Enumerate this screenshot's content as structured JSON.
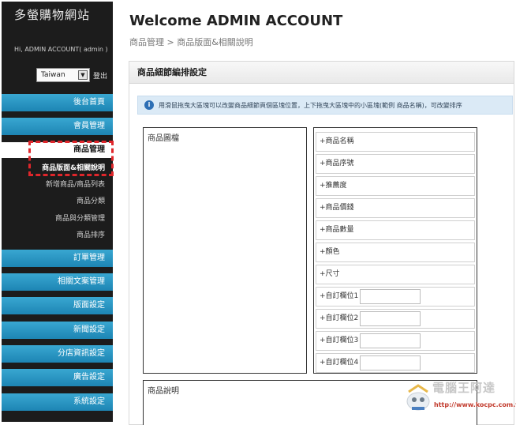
{
  "sidebar": {
    "site_title": "多螢購物網站",
    "greeting": "Hi, ADMIN ACCOUNT( admin )",
    "language": "Taiwan",
    "logout": "登出",
    "menu": {
      "home": "後台首頁",
      "members": "會員管理",
      "products": "商品管理",
      "sub_layout": "商品版面&相關說明",
      "sub_add": "新增商品/商品列表",
      "sub_category": "商品分類",
      "sub_category_mgmt": "商品與分類管理",
      "sub_sort": "商品排序",
      "orders": "訂單管理",
      "articles": "相關文案管理",
      "layout_settings": "版面設定",
      "news_settings": "新聞設定",
      "branch_settings": "分店資訊設定",
      "ad_settings": "廣告設定",
      "system_settings": "系統設定"
    },
    "colors": {
      "nav_blue": "#2a97c4",
      "highlight_red": "#e0262b"
    }
  },
  "header": {
    "title": "Welcome ADMIN ACCOUNT",
    "breadcrumb": "商品管理 > 商品版面&相關說明"
  },
  "panel": {
    "title": "商品細節編排設定",
    "info": "用滑鼠拖曳大區塊可以改變商品細節頁個區塊位置，上下拖曳大區塊中的小區塊(範例 商品名稱)，可改變排序",
    "image_block": "商品圖檔",
    "fields": [
      "+商品名稱",
      "+商品序號",
      "+推薦度",
      "+商品價錢",
      "+商品數量",
      "+顏色",
      "+尺寸",
      "+自訂欄位1",
      "+自訂欄位2",
      "+自訂欄位3",
      "+自訂欄位4"
    ],
    "description_block": "商品說明"
  },
  "watermark": {
    "title": "電腦王阿達",
    "url": "http://www.kocpc.com.tw"
  }
}
